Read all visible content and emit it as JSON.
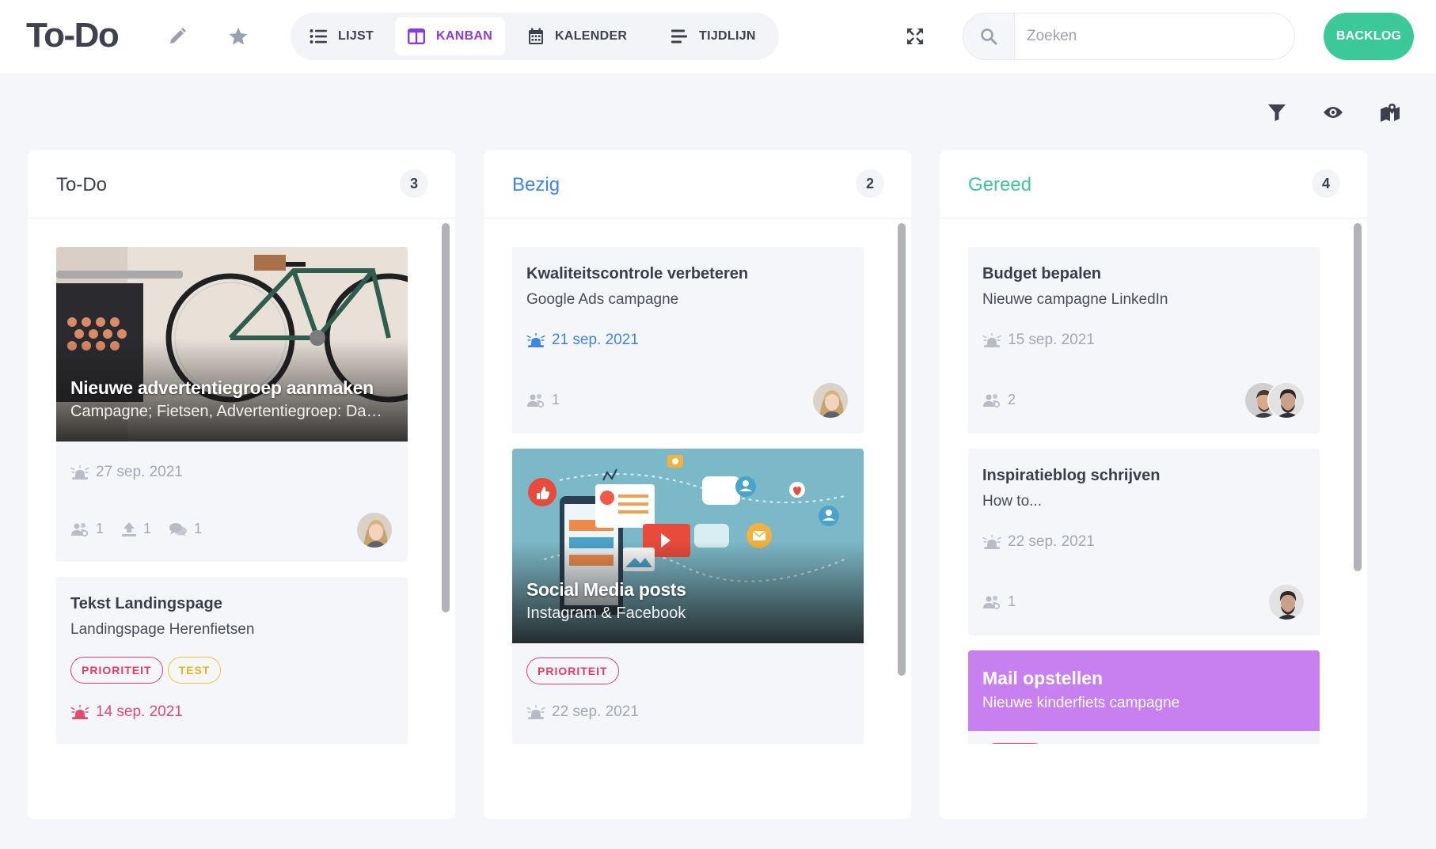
{
  "header": {
    "title": "To-Do",
    "views": [
      {
        "label": "LIJST",
        "icon": "list-icon"
      },
      {
        "label": "KANBAN",
        "icon": "kanban-icon",
        "active": true
      },
      {
        "label": "KALENDER",
        "icon": "calendar-icon"
      },
      {
        "label": "TIJDLIJN",
        "icon": "timeline-icon"
      }
    ],
    "search_placeholder": "Zoeken",
    "backlog_label": "BACKLOG"
  },
  "colors": {
    "accent": "#8a3cd4",
    "backlog": "#3cc99a",
    "bezig": "#3b86e6",
    "gereed": "#3cc99a",
    "priority": "#e63963",
    "test": "#e8b417",
    "mail_card": "#c87ff0"
  },
  "columns": [
    {
      "title": "To-Do",
      "count": "3",
      "title_color": "#3d404d",
      "cards": [
        {
          "title": "Nieuwe advertentiegroep aanmaken",
          "subtitle": "Campagne; Fietsen, Advertentiegroep: Dames",
          "date": "27 sep. 2021",
          "members": "1",
          "attachments": "1",
          "comments": "1"
        },
        {
          "title": "Tekst Landingspage",
          "subtitle": "Landingspage Herenfietsen",
          "tags": [
            "PRIORITEIT",
            "TEST"
          ],
          "date": "14 sep. 2021"
        }
      ]
    },
    {
      "title": "Bezig",
      "count": "2",
      "title_color": "#3b86e6",
      "cards": [
        {
          "title": "Kwaliteitscontrole verbeteren",
          "subtitle": "Google Ads campagne",
          "date": "21 sep. 2021",
          "members": "1"
        },
        {
          "title": "Social Media posts",
          "subtitle": "Instagram & Facebook",
          "tags": [
            "PRIORITEIT"
          ],
          "date": "22 sep. 2021"
        }
      ]
    },
    {
      "title": "Gereed",
      "count": "4",
      "title_color": "#3cc99a",
      "cards": [
        {
          "title": "Budget bepalen",
          "subtitle": "Nieuwe campagne LinkedIn",
          "date": "15 sep. 2021",
          "members": "2"
        },
        {
          "title": "Inspiratieblog schrijven",
          "subtitle": "How to...",
          "date": "22 sep. 2021",
          "members": "1"
        },
        {
          "title": "Mail opstellen",
          "subtitle": "Nieuwe kinderfiets campagne"
        }
      ]
    }
  ]
}
